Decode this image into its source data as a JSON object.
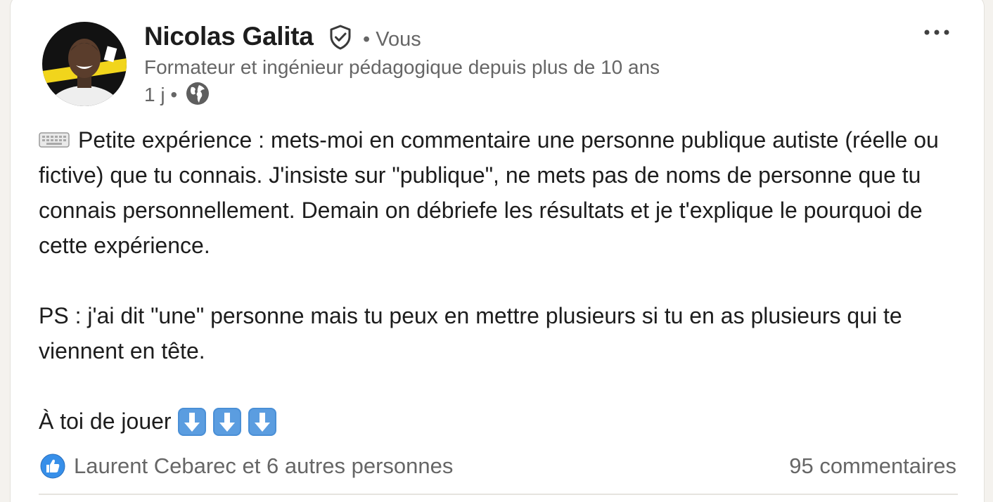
{
  "author": {
    "name": "Nicolas Galita",
    "connection": "• Vous",
    "headline": "Formateur et ingénieur pédagogique depuis plus de 10 ans",
    "time": "1 j •",
    "avatar_icon": "avatar-photo",
    "verified_icon": "verified-shield-icon",
    "visibility_icon": "globe-icon"
  },
  "post": {
    "line1": "Petite expérience : mets-moi en commentaire une personne publique autiste (réelle ou fictive) que tu connais. J'insiste sur \"publique\", ne mets pas de noms de personne que tu connais personnellement. Demain on débriefe les résultats et je t'explique le pourquoi de cette expérience.",
    "line2": "PS : j'ai dit \"une\" personne mais tu peux en mettre plusieurs si tu en as plusieurs qui te viennent en tête.",
    "line3": "À toi de jouer",
    "leading_icon": "keyboard-icon",
    "trailing_icons": [
      "down-arrow-icon",
      "down-arrow-icon",
      "down-arrow-icon"
    ]
  },
  "social": {
    "reactions_text": "Laurent Cebarec et 6 autres personnes",
    "reaction_icon": "like-icon",
    "comments_text": "95 commentaires"
  },
  "colors": {
    "like_blue": "#378fe9",
    "arrow_blue": "#4a8fd6",
    "text_primary": "#1d1d1d",
    "text_secondary": "#666666"
  }
}
